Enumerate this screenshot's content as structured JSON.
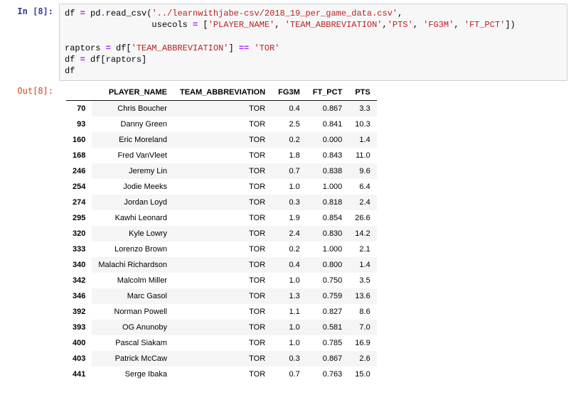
{
  "in_prompt": "In [8]:",
  "out_prompt": "Out[8]:",
  "code": {
    "l1_a": "df ",
    "l1_eq": "=",
    "l1_b": " pd",
    "l1_dot": ".",
    "l1_c": "read_csv(",
    "l1_str": "'../learnwithjabe-csv/2018_19_per_game_data.csv'",
    "l1_d": ",",
    "l2_pad": "                 usecols ",
    "l2_eq": "=",
    "l2_a": " [",
    "l2_s1": "'PLAYER_NAME'",
    "l2_c1": ", ",
    "l2_s2": "'TEAM_ABBREVIATION'",
    "l2_c2": ",",
    "l2_s3": "'PTS'",
    "l2_c3": ", ",
    "l2_s4": "'FG3M'",
    "l2_c4": ", ",
    "l2_s5": "'FT_PCT'",
    "l2_b": "])",
    "l4_a": "raptors ",
    "l4_eq": "=",
    "l4_b": " df[",
    "l4_s": "'TEAM_ABBREVIATION'",
    "l4_c": "] ",
    "l4_eqeq": "==",
    "l4_d": " ",
    "l4_s2": "'TOR'",
    "l5_a": "df ",
    "l5_eq": "=",
    "l5_b": " df[raptors]",
    "l6": "df"
  },
  "table": {
    "columns": [
      "PLAYER_NAME",
      "TEAM_ABBREVIATION",
      "FG3M",
      "FT_PCT",
      "PTS"
    ],
    "rows": [
      {
        "idx": "70",
        "PLAYER_NAME": "Chris Boucher",
        "TEAM_ABBREVIATION": "TOR",
        "FG3M": "0.4",
        "FT_PCT": "0.867",
        "PTS": "3.3"
      },
      {
        "idx": "93",
        "PLAYER_NAME": "Danny Green",
        "TEAM_ABBREVIATION": "TOR",
        "FG3M": "2.5",
        "FT_PCT": "0.841",
        "PTS": "10.3"
      },
      {
        "idx": "160",
        "PLAYER_NAME": "Eric Moreland",
        "TEAM_ABBREVIATION": "TOR",
        "FG3M": "0.2",
        "FT_PCT": "0.000",
        "PTS": "1.4"
      },
      {
        "idx": "168",
        "PLAYER_NAME": "Fred VanVleet",
        "TEAM_ABBREVIATION": "TOR",
        "FG3M": "1.8",
        "FT_PCT": "0.843",
        "PTS": "11.0"
      },
      {
        "idx": "246",
        "PLAYER_NAME": "Jeremy Lin",
        "TEAM_ABBREVIATION": "TOR",
        "FG3M": "0.7",
        "FT_PCT": "0.838",
        "PTS": "9.6"
      },
      {
        "idx": "254",
        "PLAYER_NAME": "Jodie Meeks",
        "TEAM_ABBREVIATION": "TOR",
        "FG3M": "1.0",
        "FT_PCT": "1.000",
        "PTS": "6.4"
      },
      {
        "idx": "274",
        "PLAYER_NAME": "Jordan Loyd",
        "TEAM_ABBREVIATION": "TOR",
        "FG3M": "0.3",
        "FT_PCT": "0.818",
        "PTS": "2.4"
      },
      {
        "idx": "295",
        "PLAYER_NAME": "Kawhi Leonard",
        "TEAM_ABBREVIATION": "TOR",
        "FG3M": "1.9",
        "FT_PCT": "0.854",
        "PTS": "26.6"
      },
      {
        "idx": "320",
        "PLAYER_NAME": "Kyle Lowry",
        "TEAM_ABBREVIATION": "TOR",
        "FG3M": "2.4",
        "FT_PCT": "0.830",
        "PTS": "14.2"
      },
      {
        "idx": "333",
        "PLAYER_NAME": "Lorenzo Brown",
        "TEAM_ABBREVIATION": "TOR",
        "FG3M": "0.2",
        "FT_PCT": "1.000",
        "PTS": "2.1"
      },
      {
        "idx": "340",
        "PLAYER_NAME": "Malachi Richardson",
        "TEAM_ABBREVIATION": "TOR",
        "FG3M": "0.4",
        "FT_PCT": "0.800",
        "PTS": "1.4"
      },
      {
        "idx": "342",
        "PLAYER_NAME": "Malcolm Miller",
        "TEAM_ABBREVIATION": "TOR",
        "FG3M": "1.0",
        "FT_PCT": "0.750",
        "PTS": "3.5"
      },
      {
        "idx": "346",
        "PLAYER_NAME": "Marc Gasol",
        "TEAM_ABBREVIATION": "TOR",
        "FG3M": "1.3",
        "FT_PCT": "0.759",
        "PTS": "13.6"
      },
      {
        "idx": "392",
        "PLAYER_NAME": "Norman Powell",
        "TEAM_ABBREVIATION": "TOR",
        "FG3M": "1.1",
        "FT_PCT": "0.827",
        "PTS": "8.6"
      },
      {
        "idx": "393",
        "PLAYER_NAME": "OG Anunoby",
        "TEAM_ABBREVIATION": "TOR",
        "FG3M": "1.0",
        "FT_PCT": "0.581",
        "PTS": "7.0"
      },
      {
        "idx": "400",
        "PLAYER_NAME": "Pascal Siakam",
        "TEAM_ABBREVIATION": "TOR",
        "FG3M": "1.0",
        "FT_PCT": "0.785",
        "PTS": "16.9"
      },
      {
        "idx": "403",
        "PLAYER_NAME": "Patrick McCaw",
        "TEAM_ABBREVIATION": "TOR",
        "FG3M": "0.3",
        "FT_PCT": "0.867",
        "PTS": "2.6"
      },
      {
        "idx": "441",
        "PLAYER_NAME": "Serge Ibaka",
        "TEAM_ABBREVIATION": "TOR",
        "FG3M": "0.7",
        "FT_PCT": "0.763",
        "PTS": "15.0"
      }
    ]
  }
}
